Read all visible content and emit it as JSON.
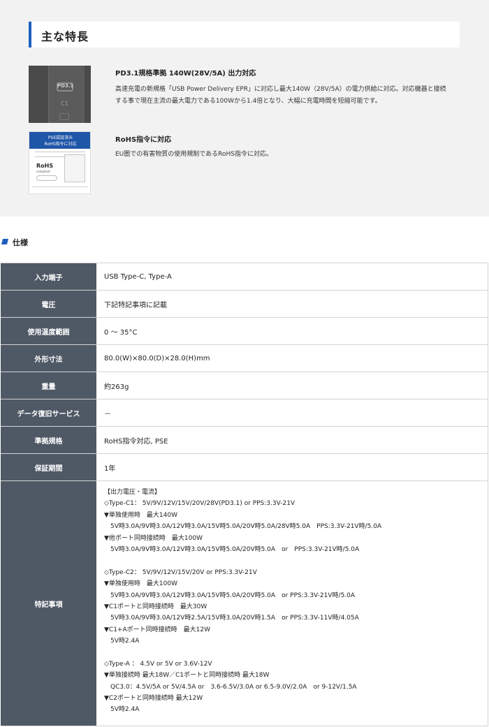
{
  "features": {
    "heading": "主な特長",
    "items": [
      {
        "title": "PD3.1規格準拠 140W(28V/5A) 出力対応",
        "desc_lines": [
          "高速充電の新規格「USB Power Delivery EPR」に対応し最大140W（28V/5A）の電力供給に対応。対応機器と接続",
          "する事で現在主流の最大電力である100Wから1.4倍となり、大幅に充電時間を短縮可能です。"
        ],
        "image": {
          "port_label": "PD3.1",
          "port_name": "C1"
        }
      },
      {
        "title": "RoHS指令に対応",
        "desc_lines": [
          "EU圏での有害物質の使用規制であるRoHS指令に対応。"
        ],
        "image": {
          "line1": "PSE認証済み",
          "line2": "RoHS指令に対応",
          "logo": "RoHS",
          "logo_sub": "compliant"
        }
      }
    ]
  },
  "spec": {
    "heading": "仕様",
    "rows": [
      {
        "label": "入力端子",
        "value": "USB Type-C, Type-A"
      },
      {
        "label": "電圧",
        "value": "下記特記事項に記載"
      },
      {
        "label": "使用温度範囲",
        "value": "0 ～ 35°C"
      },
      {
        "label": "外形寸法",
        "value": "80.0(W)×80.0(D)×28.0(H)mm"
      },
      {
        "label": "重量",
        "value": "約263g"
      },
      {
        "label": "データ復旧サービス",
        "value": "－"
      },
      {
        "label": "準拠規格",
        "value": "RoHS指令対応, PSE"
      },
      {
        "label": "保証期間",
        "value": "1年"
      }
    ],
    "notes": {
      "label": "特記事項",
      "lines": [
        "【出力電圧・電流】",
        "◇Type-C1： 5V/9V/12V/15V/20V/28V(PD3.1) or PPS:3.3V-21V",
        "▼単独使用時　最大140W",
        "　5V時3.0A/9V時3.0A/12V時3.0A/15V時5.0A/20V時5.0A/28V時5.0A　PPS:3.3V-21V時/5.0A",
        "▼他ポート同時接続時　最大100W",
        "　5V時3.0A/9V時3.0A/12V時3.0A/15V時5.0A/20V時5.0A　or　PPS:3.3V-21V時/5.0A",
        "",
        "◇Type-C2： 5V/9V/12V/15V/20V or PPS:3.3V-21V",
        "▼単独使用時　最大100W",
        "　5V時3.0A/9V時3.0A/12V時3.0A/15V時5.0A/20V時5.0A　or PPS:3.3V-21V時/5.0A",
        "▼C1ポートと同時接続時　最大30W",
        "　5V時3.0A/9V時3.0A/12V時2.5A/15V時3.0A/20V時1.5A　or PPS:3.3V-11V時/4.05A",
        "▼C1+Aポート同時接続時　最大12W",
        "　5V時2.4A",
        "",
        "◇Type-A ： 4.5V or 5V or 3.6V-12V",
        "▼単独接続時 最大18W／C1ポートと同時接続時 最大18W",
        "　QC3.0：4.5V/5A or 5V/4.5A or　3.6-6.5V/3.0A or 6.5-9.0V/2.0A　or 9-12V/1.5A",
        "▼C2ポートと同時接続時 最大12W",
        "　5V時2.4A"
      ]
    }
  }
}
